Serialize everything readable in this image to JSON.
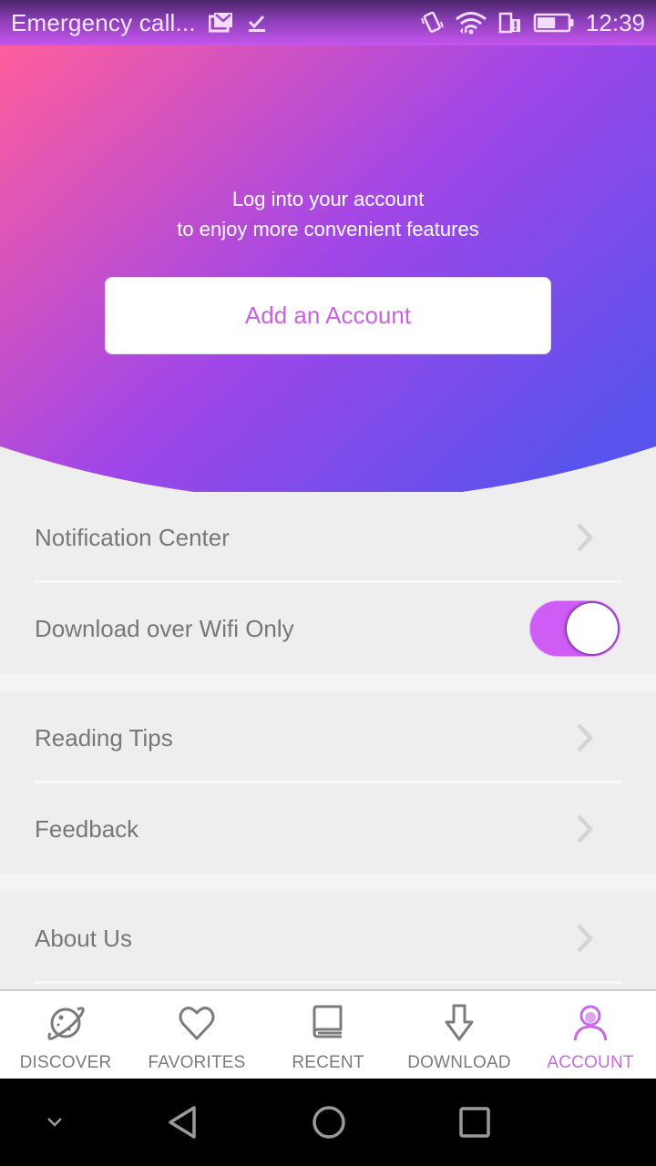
{
  "status_bar": {
    "notification_text": "Emergency call...",
    "left_icons": [
      "gmail-stack-icon",
      "checkmark-download-icon"
    ],
    "right_icons": [
      "vibrate-icon",
      "wifi-icon",
      "sim-alert-icon",
      "battery-icon"
    ],
    "time": "12:39",
    "battery_level": 0.6
  },
  "hero": {
    "line1": "Log into your account",
    "line2": "to enjoy more convenient features",
    "add_account_label": "Add an Account",
    "gradient_colors": [
      "#ff5e9c",
      "#a046e8",
      "#5a52ec"
    ]
  },
  "settings": {
    "groups": [
      {
        "items": [
          {
            "label": "Notification Center",
            "control": "chevron-right-icon"
          },
          {
            "label": "Download over Wifi Only",
            "control": "toggle",
            "toggle_on": true
          }
        ]
      },
      {
        "items": [
          {
            "label": "Reading Tips",
            "control": "chevron-right-icon"
          },
          {
            "label": "Feedback",
            "control": "chevron-right-icon"
          }
        ]
      },
      {
        "items": [
          {
            "label": "About Us",
            "control": "chevron-right-icon"
          }
        ]
      }
    ]
  },
  "tab_bar": {
    "tabs": [
      {
        "label": "DISCOVER",
        "icon": "planet-icon",
        "active": false
      },
      {
        "label": "FAVORITES",
        "icon": "heart-icon",
        "active": false
      },
      {
        "label": "RECENT",
        "icon": "book-icon",
        "active": false
      },
      {
        "label": "DOWNLOAD",
        "icon": "download-arrow-icon",
        "active": false
      },
      {
        "label": "ACCOUNT",
        "icon": "user-icon",
        "active": true
      }
    ],
    "active_color": "#c869e6",
    "inactive_color": "#7b7b7b"
  },
  "system_nav": {
    "buttons": [
      "collapse-chevron-icon",
      "back-icon",
      "home-icon",
      "recents-icon"
    ]
  },
  "colors": {
    "accent": "#c963e0",
    "toggle_on": "#cf5cf5",
    "list_text": "#777777",
    "background": "#eeeeee"
  }
}
